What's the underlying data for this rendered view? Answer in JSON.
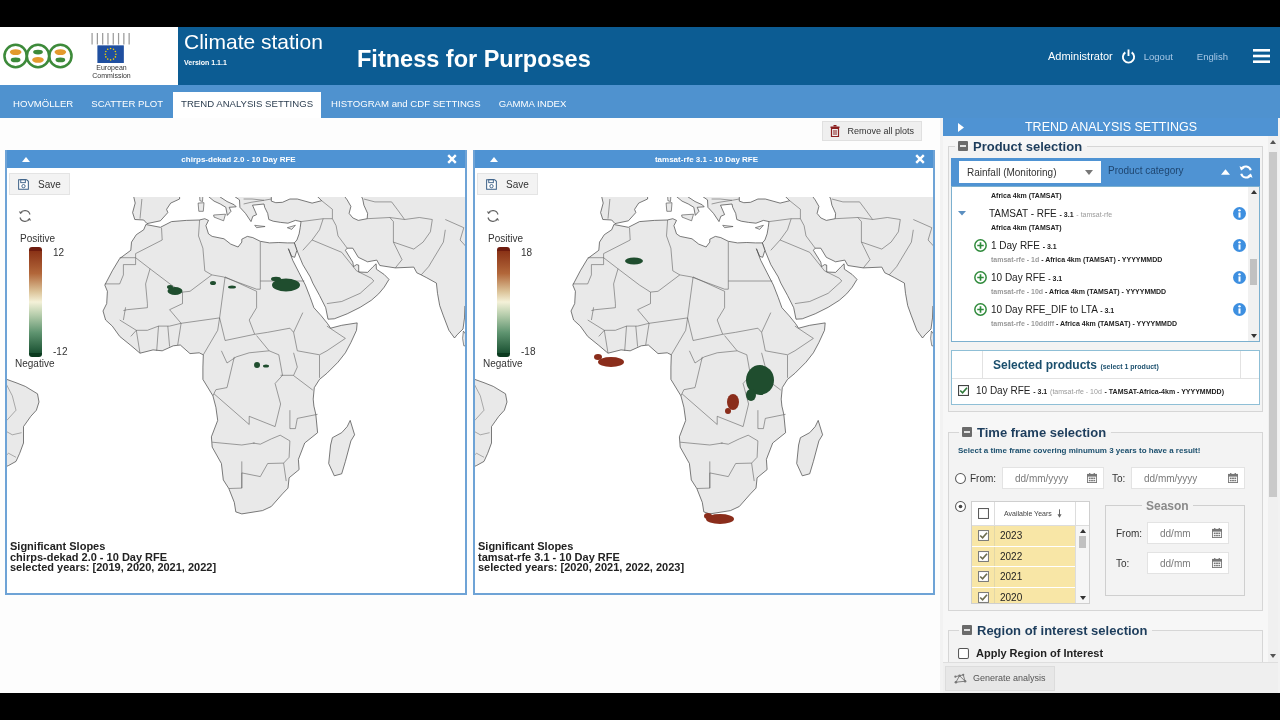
{
  "header": {
    "logo_caption": "European Commission",
    "app_title": "Climate station",
    "version": "Version 1.1.1",
    "page_title": "Fitness for Purposes",
    "user": "Administrator",
    "logout": "Logout",
    "language": "English"
  },
  "tabs": [
    {
      "label": "HOVMÖLLER",
      "selected": false
    },
    {
      "label": "SCATTER PLOT",
      "selected": false
    },
    {
      "label": "TREND ANALYSIS SETTINGS",
      "selected": true
    },
    {
      "label": "HISTOGRAM and CDF SETTINGS",
      "selected": false
    },
    {
      "label": "GAMMA INDEX",
      "selected": false
    }
  ],
  "workspace": {
    "remove_all": "Remove all plots",
    "plots": [
      {
        "title": "chirps-dekad 2.0 - 10 Day RFE",
        "save": "Save",
        "legend": {
          "positive": "Positive",
          "max": "12",
          "min": "-12",
          "negative": "Negative"
        },
        "caption": [
          "Significant Slopes",
          "chirps-dekad 2.0 - 10 Day RFE",
          "selected years: [2019, 2020, 2021, 2022]"
        ]
      },
      {
        "title": "tamsat-rfe 3.1 - 10 Day RFE",
        "save": "Save",
        "legend": {
          "positive": "Positive",
          "max": "18",
          "min": "-18",
          "negative": "Negative"
        },
        "caption": [
          "Significant Slopes",
          "tamsat-rfe 3.1 - 10 Day RFE",
          "selected years: [2020, 2021, 2022, 2023]"
        ]
      }
    ]
  },
  "settings": {
    "title": "TREND ANALYSIS SETTINGS",
    "product_selection": {
      "title": "Product selection",
      "expanded": true,
      "category": {
        "value": "Rainfall (Monitoring)",
        "label": "Product category"
      },
      "products": [
        {
          "kind": "note",
          "text": "Africa 4km (TAMSAT)"
        },
        {
          "kind": "group",
          "name": "TAMSAT - RFE",
          "version": "- 3.1",
          "code": "- tamsat-rfe",
          "expanded": true,
          "note": "Africa 4km (TAMSAT)",
          "children": [
            {
              "name": "1 Day RFE",
              "version": "- 3.1",
              "code": "tamsat-rfe - 1d",
              "detail": "- Africa 4km (TAMSAT) - YYYYMMDD"
            },
            {
              "name": "10 Day RFE",
              "version": "- 3.1",
              "code": "tamsat-rfe - 10d",
              "detail": "- Africa 4km (TAMSAT) - YYYYMMDD"
            },
            {
              "name": "10 Day RFE_DIF to LTA",
              "version": "- 3.1",
              "code": "tamsat-rfe - 10ddiff",
              "detail": "- Africa 4km (TAMSAT) - YYYYMMDD"
            }
          ]
        }
      ],
      "selected": {
        "title": "Selected products",
        "hint": "(select 1 product)",
        "items": [
          {
            "checked": true,
            "name": "10 Day RFE",
            "version": "- 3.1",
            "code": "(tamsat-rfe - 10d",
            "detail": "- TAMSAT-Africa-4km - YYYYMMDD)"
          }
        ]
      }
    },
    "time_frame": {
      "title": "Time frame selection",
      "expanded": true,
      "hint": "Select a time frame covering minumum 3 years to have a result!",
      "range": {
        "selected": false,
        "from_label": "From:",
        "from_placeholder": "dd/mm/yyyy",
        "to_label": "To:",
        "to_placeholder": "dd/mm/yyyy"
      },
      "years": {
        "selected": true,
        "header": "Available Years",
        "all_checked": false,
        "items": [
          {
            "label": "2023",
            "checked": true
          },
          {
            "label": "2022",
            "checked": true
          },
          {
            "label": "2021",
            "checked": true
          },
          {
            "label": "2020",
            "checked": true
          }
        ]
      },
      "season": {
        "title": "Season",
        "from_label": "From:",
        "from_placeholder": "dd/mm",
        "to_label": "To:",
        "to_placeholder": "dd/mm"
      }
    },
    "region": {
      "title": "Region of interest selection",
      "expanded": true,
      "apply": {
        "label": "Apply Region of Interest",
        "checked": false
      }
    },
    "generate": "Generate analysis"
  }
}
